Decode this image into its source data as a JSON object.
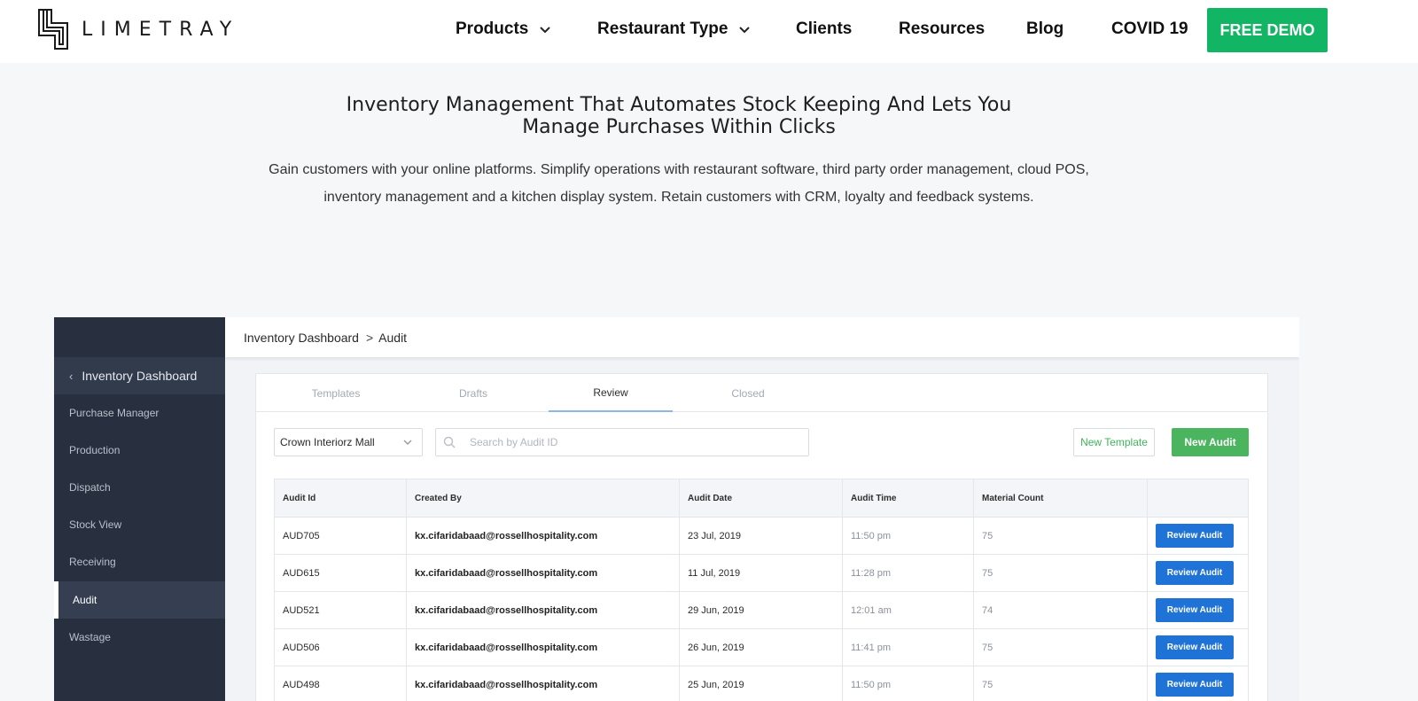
{
  "brand": {
    "name": "LIMETRAY",
    "logo_icon": "limetray-logo-icon"
  },
  "nav": {
    "items": [
      {
        "label": "Products",
        "has_dropdown": true
      },
      {
        "label": "Restaurant Type",
        "has_dropdown": true
      },
      {
        "label": "Clients",
        "has_dropdown": false
      },
      {
        "label": "Resources",
        "has_dropdown": false
      },
      {
        "label": "Blog",
        "has_dropdown": false
      },
      {
        "label": "COVID 19",
        "has_dropdown": false
      }
    ],
    "cta_label": "FREE DEMO"
  },
  "hero": {
    "title_line1": "Inventory Management That Automates Stock Keeping And Lets You",
    "title_line2": "Manage Purchases Within Clicks",
    "subtitle_line1": "Gain customers with your online platforms. Simplify operations with restaurant software, third party order management, cloud POS,",
    "subtitle_line2": "inventory management and a kitchen display system. Retain customers with CRM, loyalty and feedback systems."
  },
  "dashboard": {
    "breadcrumb": {
      "parent": "Inventory Dashboard",
      "separator": ">",
      "current": "Audit"
    },
    "sidebar": {
      "header": "Inventory Dashboard",
      "items": [
        {
          "label": "Purchase Manager",
          "active": false
        },
        {
          "label": "Production",
          "active": false
        },
        {
          "label": "Dispatch",
          "active": false
        },
        {
          "label": "Stock View",
          "active": false
        },
        {
          "label": "Receiving",
          "active": false
        },
        {
          "label": "Audit",
          "active": true
        },
        {
          "label": "Wastage",
          "active": false
        }
      ]
    },
    "tabs": [
      {
        "label": "Templates",
        "active": false
      },
      {
        "label": "Drafts",
        "active": false
      },
      {
        "label": "Review",
        "active": true
      },
      {
        "label": "Closed",
        "active": false
      }
    ],
    "location_select": {
      "value": "Crown Interiorz Mall"
    },
    "search": {
      "placeholder": "Search by Audit ID",
      "value": ""
    },
    "buttons": {
      "new_template": "New Template",
      "new_audit": "New Audit"
    },
    "table": {
      "columns": [
        "Audit Id",
        "Created By",
        "Audit Date",
        "Audit Time",
        "Material Count",
        ""
      ],
      "row_action_label": "Review Audit",
      "rows": [
        {
          "id": "AUD705",
          "created_by": "kx.cifaridabaad@rossellhospitality.com",
          "date": "23 Jul, 2019",
          "time": "11:50 pm",
          "count": "75"
        },
        {
          "id": "AUD615",
          "created_by": "kx.cifaridabaad@rossellhospitality.com",
          "date": "11 Jul, 2019",
          "time": "11:28 pm",
          "count": "75"
        },
        {
          "id": "AUD521",
          "created_by": "kx.cifaridabaad@rossellhospitality.com",
          "date": "29 Jun, 2019",
          "time": "12:01 am",
          "count": "74"
        },
        {
          "id": "AUD506",
          "created_by": "kx.cifaridabaad@rossellhospitality.com",
          "date": "26 Jun, 2019",
          "time": "11:41 pm",
          "count": "75"
        },
        {
          "id": "AUD498",
          "created_by": "kx.cifaridabaad@rossellhospitality.com",
          "date": "25 Jun, 2019",
          "time": "11:50 pm",
          "count": "75"
        }
      ]
    }
  },
  "colors": {
    "cta_green": "#12b563",
    "sidebar_bg": "#28303f",
    "review_blue": "#1f73d6",
    "audit_green": "#4ab45e"
  }
}
